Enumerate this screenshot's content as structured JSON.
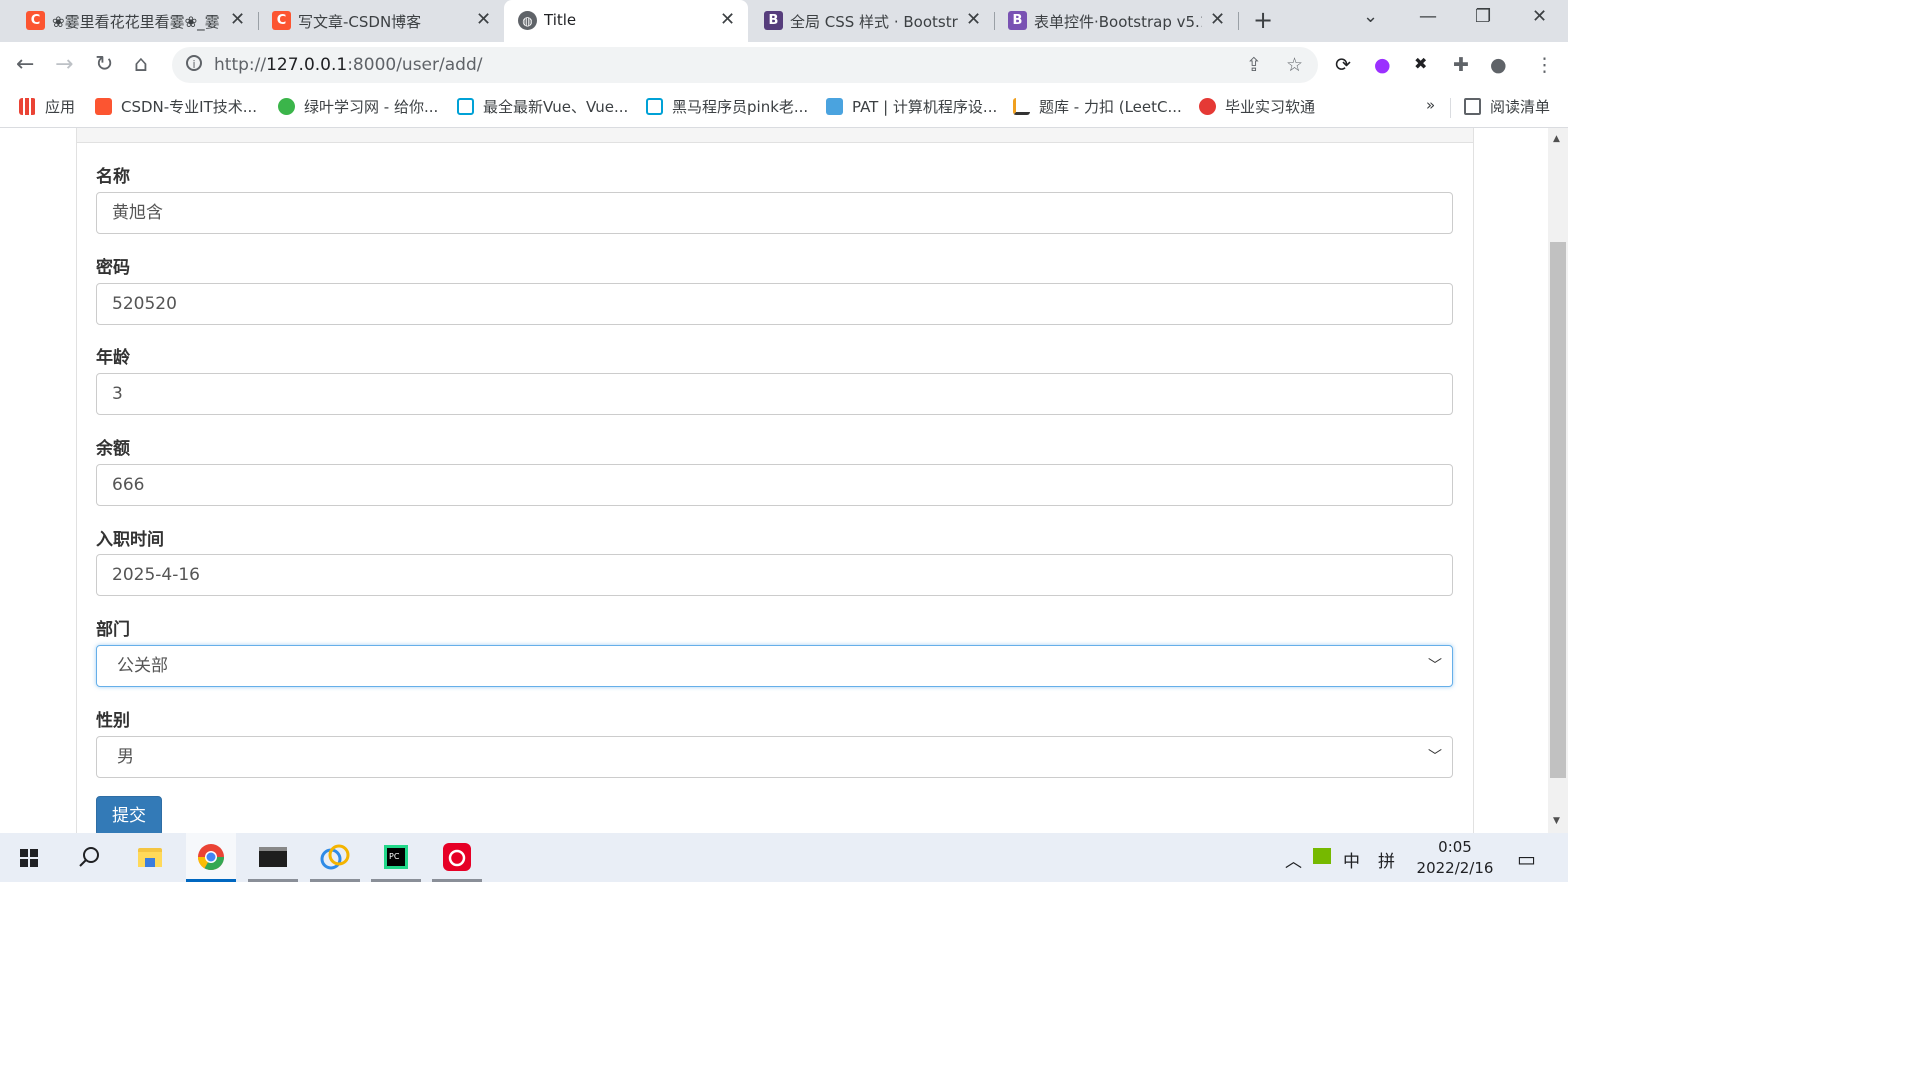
{
  "browser": {
    "tabs": [
      {
        "title": "❀霎里看花花里看霎❀_霎",
        "active": false,
        "favicon": "C",
        "favicon_color": "#fc5531"
      },
      {
        "title": "写文章-CSDN博客",
        "active": false,
        "favicon": "C",
        "favicon_color": "#fc5531"
      },
      {
        "title": "Title",
        "active": true,
        "favicon": "globe",
        "favicon_color": "#5f6368"
      },
      {
        "title": "全局 CSS 样式 · Bootstra",
        "active": false,
        "favicon": "B",
        "favicon_color": "#563d7c"
      },
      {
        "title": "表单控件·Bootstrap v5.1",
        "active": false,
        "favicon": "B",
        "favicon_color": "#7952b3"
      }
    ],
    "url_prefix": "http://",
    "url_host": "127.0.0.1",
    "url_rest": ":8000/user/add/",
    "bookmarks": [
      {
        "label": "应用",
        "icon": "apps-grid-icon"
      },
      {
        "label": "CSDN-专业IT技术...",
        "icon": "csdn-icon"
      },
      {
        "label": "绿叶学习网 - 给你...",
        "icon": "leaf-icon"
      },
      {
        "label": "最全最新Vue、Vue...",
        "icon": "bilibili-icon"
      },
      {
        "label": "黑马程序员pink老...",
        "icon": "bilibili-icon"
      },
      {
        "label": "PAT | 计算机程序设...",
        "icon": "pat-icon"
      },
      {
        "label": "题库 - 力扣 (LeetC...",
        "icon": "leetcode-icon"
      },
      {
        "label": "毕业实习软通",
        "icon": "softstone-icon"
      }
    ],
    "bookmarks_overflow": "»",
    "reading_list": "阅读清单"
  },
  "form": {
    "fields": [
      {
        "label": "名称",
        "value": "黄旭含"
      },
      {
        "label": "密码",
        "value": "520520"
      },
      {
        "label": "年龄",
        "value": "3"
      },
      {
        "label": "余额",
        "value": "666"
      },
      {
        "label": "入职时间",
        "value": "2025-4-16"
      }
    ],
    "department": {
      "label": "部门",
      "value": "公关部"
    },
    "gender": {
      "label": "性别",
      "value": "男"
    },
    "submit_label": "提交"
  },
  "taskbar": {
    "ime_lang": "中",
    "ime_mode": "拼",
    "time": "0:05",
    "date": "2022/2/16"
  },
  "colors": {
    "primary_button": "#337ab7",
    "focus_border": "#66afe9",
    "tab_strip": "#dee1e6"
  }
}
